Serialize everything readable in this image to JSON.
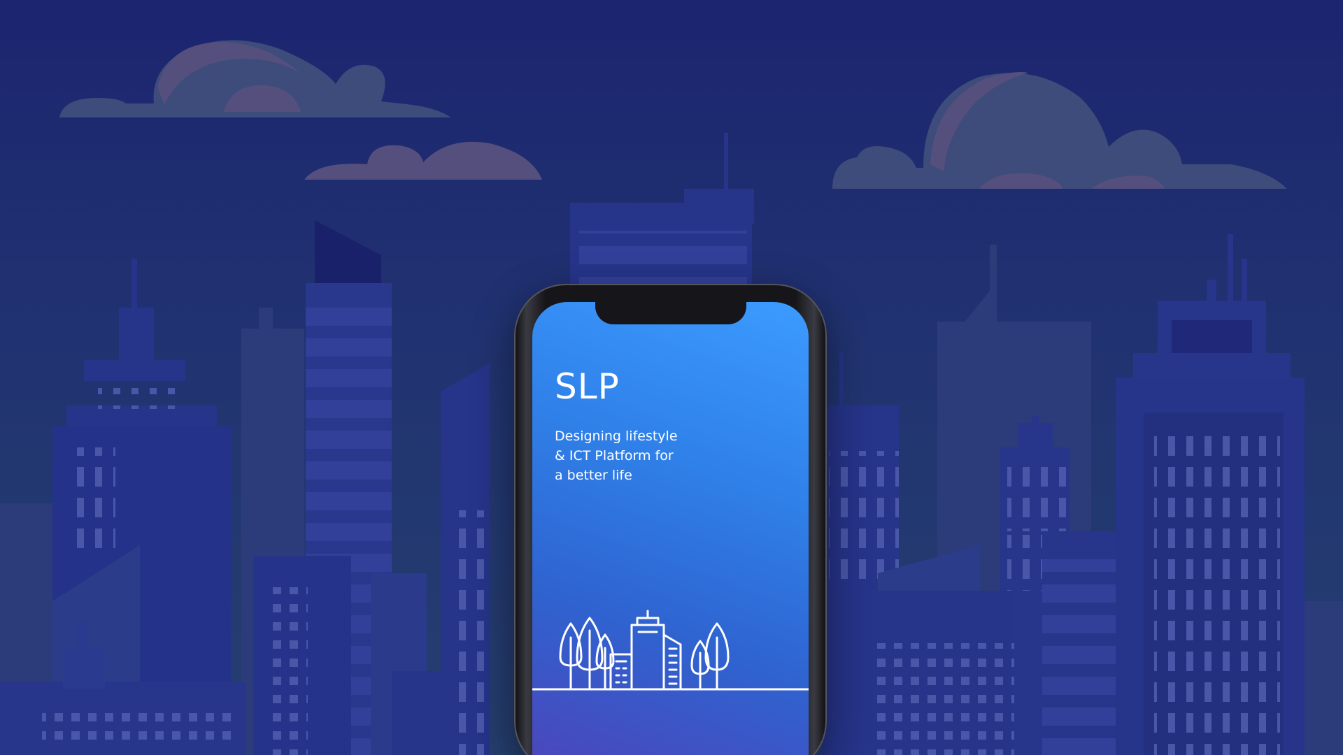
{
  "colors": {
    "sky_top": "#1e2a72",
    "sky_bottom": "#243d70",
    "cloud": "#3d4c7a",
    "cloud_shadow": "#554f7e",
    "building_far": "#2b3c7c",
    "building_mid": "#26358a",
    "building_near": "#233187",
    "window": "#4a57a8",
    "screen_top": "#3c9bff",
    "screen_bottom": "#4f42b8",
    "line_art": "#ffffff"
  },
  "app": {
    "logo_text": "SLP",
    "tagline": [
      "Designing lifestyle",
      "& ICT Platform for",
      "a better life"
    ]
  },
  "icons": {
    "city_illustration": "city-skyline-with-trees-icon"
  }
}
